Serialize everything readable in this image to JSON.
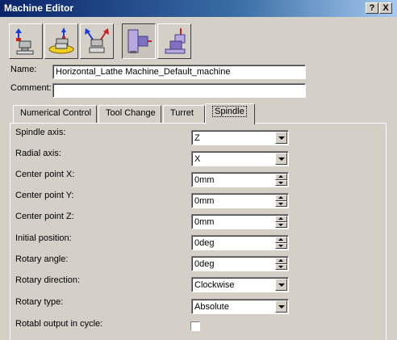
{
  "window": {
    "title": "Machine Editor",
    "help_label": "?",
    "close_label": "X"
  },
  "toolbar": {
    "buttons": [
      {
        "name": "machine-spindle-icon"
      },
      {
        "name": "rotary-table-icon"
      },
      {
        "name": "tool-change-icon"
      },
      {
        "name": "lathe-spindle-icon",
        "pressed": true
      },
      {
        "name": "turret-icon"
      }
    ]
  },
  "form": {
    "name_label": "Name:",
    "name_value": "Horizontal_Lathe Machine_Default_machine",
    "comment_label": "Comment:",
    "comment_value": ""
  },
  "tabs": [
    {
      "label": "Numerical Control",
      "active": false
    },
    {
      "label": "Tool Change",
      "active": false
    },
    {
      "label": "Turret",
      "active": false
    },
    {
      "label": "Spindle",
      "active": true
    }
  ],
  "spindle": {
    "spindle_axis": {
      "label": "Spindle axis:",
      "value": "Z"
    },
    "radial_axis": {
      "label": "Radial axis:",
      "value": "X"
    },
    "center_x": {
      "label": "Center point X:",
      "value": "0mm"
    },
    "center_y": {
      "label": "Center point Y:",
      "value": "0mm"
    },
    "center_z": {
      "label": "Center point Z:",
      "value": "0mm"
    },
    "initial_position": {
      "label": "Initial position:",
      "value": "0deg"
    },
    "rotary_angle": {
      "label": "Rotary angle:",
      "value": "0deg"
    },
    "rotary_direction": {
      "label": "Rotary direction:",
      "value": "Clockwise"
    },
    "rotary_type": {
      "label": "Rotary type:",
      "value": "Absolute"
    },
    "rotabl_output": {
      "label": "Rotabl output in cycle:",
      "checked": false
    }
  },
  "colors": {
    "titlebar_start": "#0a246a",
    "titlebar_end": "#a6caf0",
    "face": "#d4d0c8"
  }
}
